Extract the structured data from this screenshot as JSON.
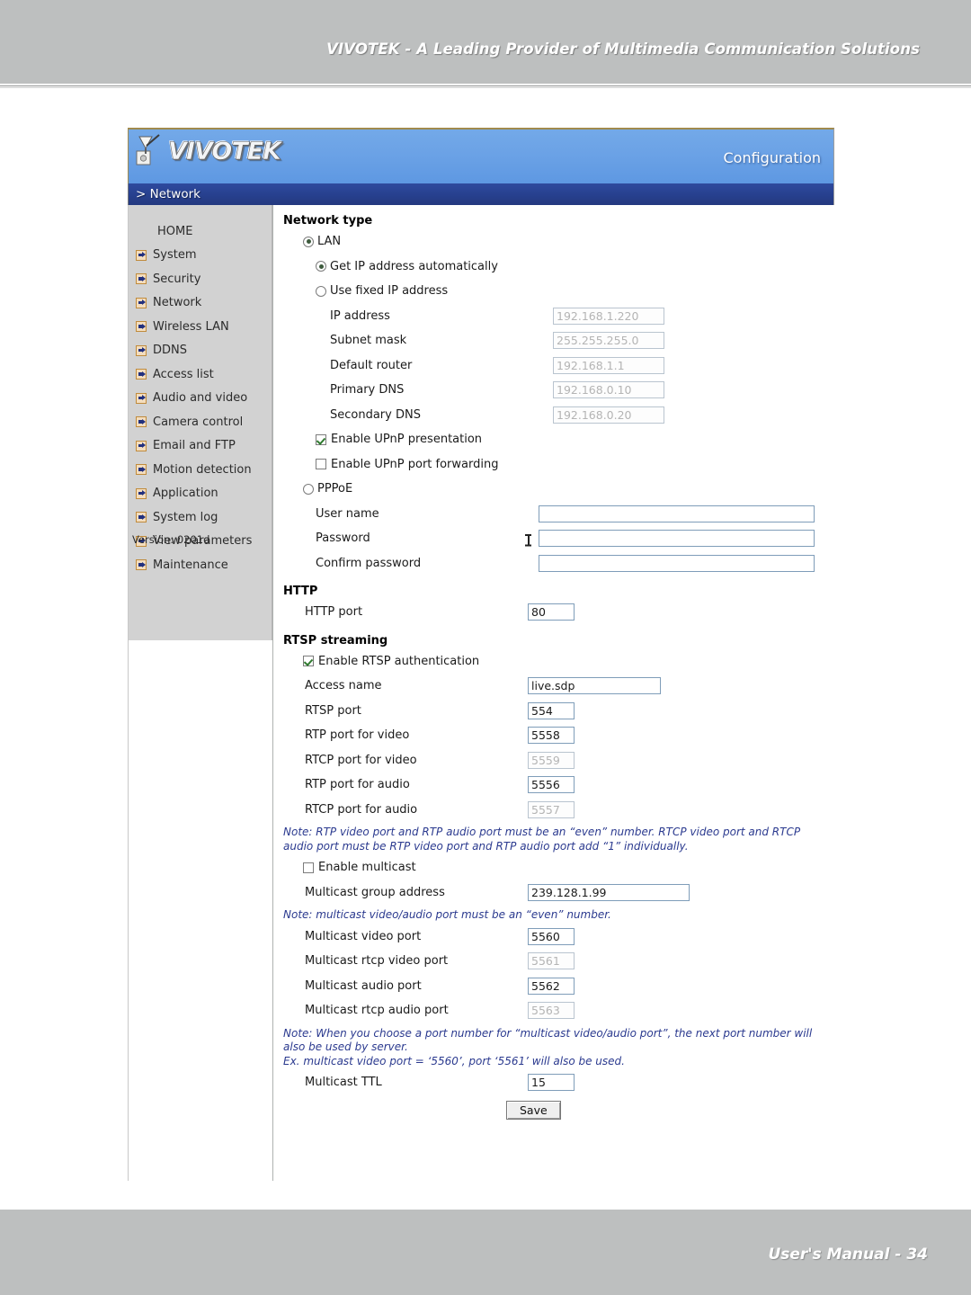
{
  "page": {
    "header_title": "VIVOTEK - A Leading Provider of Multimedia Communication Solutions",
    "footer_title": "User's Manual - 34"
  },
  "app": {
    "brand": "VIVOTEK",
    "brand_icon": "vivotek-logo-icon",
    "configuration_label": "Configuration",
    "breadcrumb": "> Network"
  },
  "sidebar": {
    "version": "Version: 0201d",
    "items": [
      {
        "label": "HOME",
        "icon": null
      },
      {
        "label": "System",
        "icon": "arrow-right-icon"
      },
      {
        "label": "Security",
        "icon": "arrow-right-icon"
      },
      {
        "label": "Network",
        "icon": "arrow-right-icon"
      },
      {
        "label": "Wireless LAN",
        "icon": "arrow-right-icon"
      },
      {
        "label": "DDNS",
        "icon": "arrow-right-icon"
      },
      {
        "label": "Access list",
        "icon": "arrow-right-icon"
      },
      {
        "label": "Audio and video",
        "icon": "arrow-right-icon"
      },
      {
        "label": "Camera control",
        "icon": "arrow-right-icon"
      },
      {
        "label": "Email and FTP",
        "icon": "arrow-right-icon"
      },
      {
        "label": "Motion detection",
        "icon": "arrow-right-icon"
      },
      {
        "label": "Application",
        "icon": "arrow-right-icon"
      },
      {
        "label": "System log",
        "icon": "arrow-right-icon"
      },
      {
        "label": "View parameters",
        "icon": "arrow-right-icon"
      },
      {
        "label": "Maintenance",
        "icon": "arrow-right-icon"
      }
    ]
  },
  "form": {
    "network_type": {
      "heading": "Network type",
      "lan_label": "LAN",
      "lan_selected": true,
      "get_ip_auto_label": "Get IP address automatically",
      "get_ip_auto_selected": true,
      "use_fixed_label": "Use fixed IP address",
      "use_fixed_selected": false,
      "fields": [
        {
          "label": "IP address",
          "value": "192.168.1.220",
          "disabled": true
        },
        {
          "label": "Subnet mask",
          "value": "255.255.255.0",
          "disabled": true
        },
        {
          "label": "Default router",
          "value": "192.168.1.1",
          "disabled": true
        },
        {
          "label": "Primary DNS",
          "value": "192.168.0.10",
          "disabled": true
        },
        {
          "label": "Secondary DNS",
          "value": "192.168.0.20",
          "disabled": true
        }
      ],
      "upnp_presentation_label": "Enable UPnP presentation",
      "upnp_presentation_checked": true,
      "upnp_port_forwarding_label": "Enable UPnP port forwarding",
      "upnp_port_forwarding_checked": false
    },
    "pppoe": {
      "label": "PPPoE",
      "selected": false,
      "fields": [
        {
          "label": "User name",
          "value": ""
        },
        {
          "label": "Password",
          "value": ""
        },
        {
          "label": "Confirm password",
          "value": ""
        }
      ]
    },
    "http": {
      "heading": "HTTP",
      "port_label": "HTTP port",
      "port_value": "80"
    },
    "rtsp": {
      "heading": "RTSP streaming",
      "auth_label": "Enable RTSP authentication",
      "auth_checked": true,
      "access_name_label": "Access name",
      "access_name_value": "live.sdp",
      "ports": [
        {
          "label": "RTSP port",
          "value": "554",
          "disabled": false
        },
        {
          "label": "RTP port for video",
          "value": "5558",
          "disabled": false
        },
        {
          "label": "RTCP port for video",
          "value": "5559",
          "disabled": true
        },
        {
          "label": "RTP port for audio",
          "value": "5556",
          "disabled": false
        },
        {
          "label": "RTCP port for audio",
          "value": "5557",
          "disabled": true
        }
      ],
      "note_ports": "Note: RTP video port and RTP audio port must be an “even” number. RTCP video port and RTCP audio port must be RTP video port and RTP audio port add “1” individually."
    },
    "multicast": {
      "enable_label": "Enable multicast",
      "enable_checked": false,
      "group_address_label": "Multicast group address",
      "group_address_value": "239.128.1.99",
      "note_even": "Note: multicast video/audio port must be an “even” number.",
      "ports": [
        {
          "label": "Multicast video port",
          "value": "5560",
          "disabled": false
        },
        {
          "label": "Multicast rtcp video port",
          "value": "5561",
          "disabled": true
        },
        {
          "label": "Multicast audio port",
          "value": "5562",
          "disabled": false
        },
        {
          "label": "Multicast rtcp audio port",
          "value": "5563",
          "disabled": true
        }
      ],
      "note_next_port_line1": "Note: When you choose a port number for “multicast video/audio port”, the next port number will also be used by server.",
      "note_next_port_line2": "Ex. multicast video port = ‘5560’, port ‘5561’ will also be used.",
      "ttl_label": "Multicast TTL",
      "ttl_value": "15"
    },
    "save_label": "Save"
  }
}
